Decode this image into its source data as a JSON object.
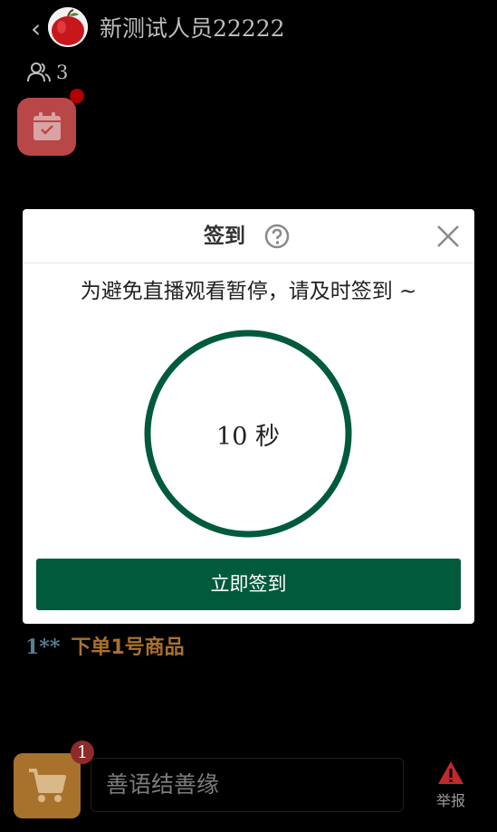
{
  "header": {
    "back_glyph": "‹",
    "room_title": "新测试人员22222",
    "viewer_count": "3"
  },
  "chat": {
    "user": "1**",
    "message": "下单1号商品"
  },
  "bottom_bar": {
    "cart_badge": "1",
    "comment_placeholder": "善语结善缘",
    "report_label": "举报"
  },
  "modal": {
    "title": "签到",
    "description": "为避免直播观看暂停，请及时签到 ~",
    "countdown": "10 秒",
    "button_label": "立即签到"
  },
  "colors": {
    "accent_green": "#005a3c",
    "checkin_red": "#b94747",
    "cart_gold": "#a8722d",
    "chat_user_blue": "#5a7f95"
  },
  "icons": [
    "chevron-left-icon",
    "avatar-apple",
    "users-icon",
    "calendar-check-icon",
    "cart-icon",
    "warning-icon",
    "help-circle-icon",
    "close-icon"
  ]
}
